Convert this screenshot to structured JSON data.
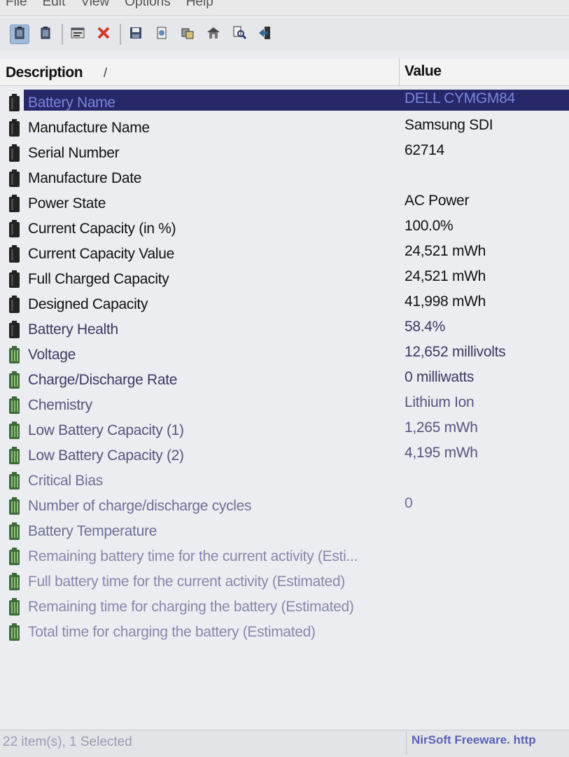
{
  "menu": [
    "File",
    "Edit",
    "View",
    "Options",
    "Help"
  ],
  "toolbar": {
    "buttons": [
      {
        "name": "battery-icon",
        "active": true
      },
      {
        "name": "battery-icon",
        "active": false
      },
      {
        "name": "sep"
      },
      {
        "name": "properties-icon",
        "active": false
      },
      {
        "name": "delete-icon",
        "active": false
      },
      {
        "name": "sep"
      },
      {
        "name": "save-icon",
        "active": false
      },
      {
        "name": "html-report-icon",
        "active": false
      },
      {
        "name": "copy-icon",
        "active": false
      },
      {
        "name": "refresh-icon",
        "active": false
      },
      {
        "name": "find-icon",
        "active": false
      },
      {
        "name": "exit-icon",
        "active": false
      }
    ]
  },
  "header": {
    "description": "Description",
    "sort_indicator": "/",
    "value": "Value"
  },
  "rows": [
    {
      "desc": "Battery Name",
      "value": "DELL CYMGM84",
      "selected": true
    },
    {
      "desc": "Manufacture Name",
      "value": "Samsung SDI"
    },
    {
      "desc": "Serial Number",
      "value": "62714"
    },
    {
      "desc": "Manufacture Date",
      "value": ""
    },
    {
      "desc": "Power State",
      "value": "AC Power"
    },
    {
      "desc": "Current Capacity (in %)",
      "value": "100.0%"
    },
    {
      "desc": "Current Capacity Value",
      "value": "24,521 mWh"
    },
    {
      "desc": "Full Charged Capacity",
      "value": "24,521 mWh"
    },
    {
      "desc": "Designed Capacity",
      "value": "41,998 mWh"
    },
    {
      "desc": "Battery Health",
      "value": "58.4%"
    },
    {
      "desc": "Voltage",
      "value": "12,652 millivolts"
    },
    {
      "desc": "Charge/Discharge Rate",
      "value": "0 milliwatts"
    },
    {
      "desc": "Chemistry",
      "value": "Lithium Ion"
    },
    {
      "desc": "Low Battery Capacity (1)",
      "value": "1,265 mWh"
    },
    {
      "desc": "Low Battery Capacity (2)",
      "value": "4,195 mWh"
    },
    {
      "desc": "Critical Bias",
      "value": ""
    },
    {
      "desc": "Number of charge/discharge cycles",
      "value": "0"
    },
    {
      "desc": "Battery Temperature",
      "value": ""
    },
    {
      "desc": "Remaining battery time for the current activity (Esti...",
      "value": ""
    },
    {
      "desc": "Full battery time for the current activity (Estimated)",
      "value": ""
    },
    {
      "desc": "Remaining time for charging the battery (Estimated)",
      "value": ""
    },
    {
      "desc": "Total time for charging the battery (Estimated)",
      "value": ""
    }
  ],
  "status": {
    "items": "22 item(s), 1 Selected",
    "credit": "NirSoft Freeware. http"
  },
  "colors": {
    "selection": "#26286a",
    "battery_dark": "#222222",
    "battery_green": "#3c6a3a"
  }
}
